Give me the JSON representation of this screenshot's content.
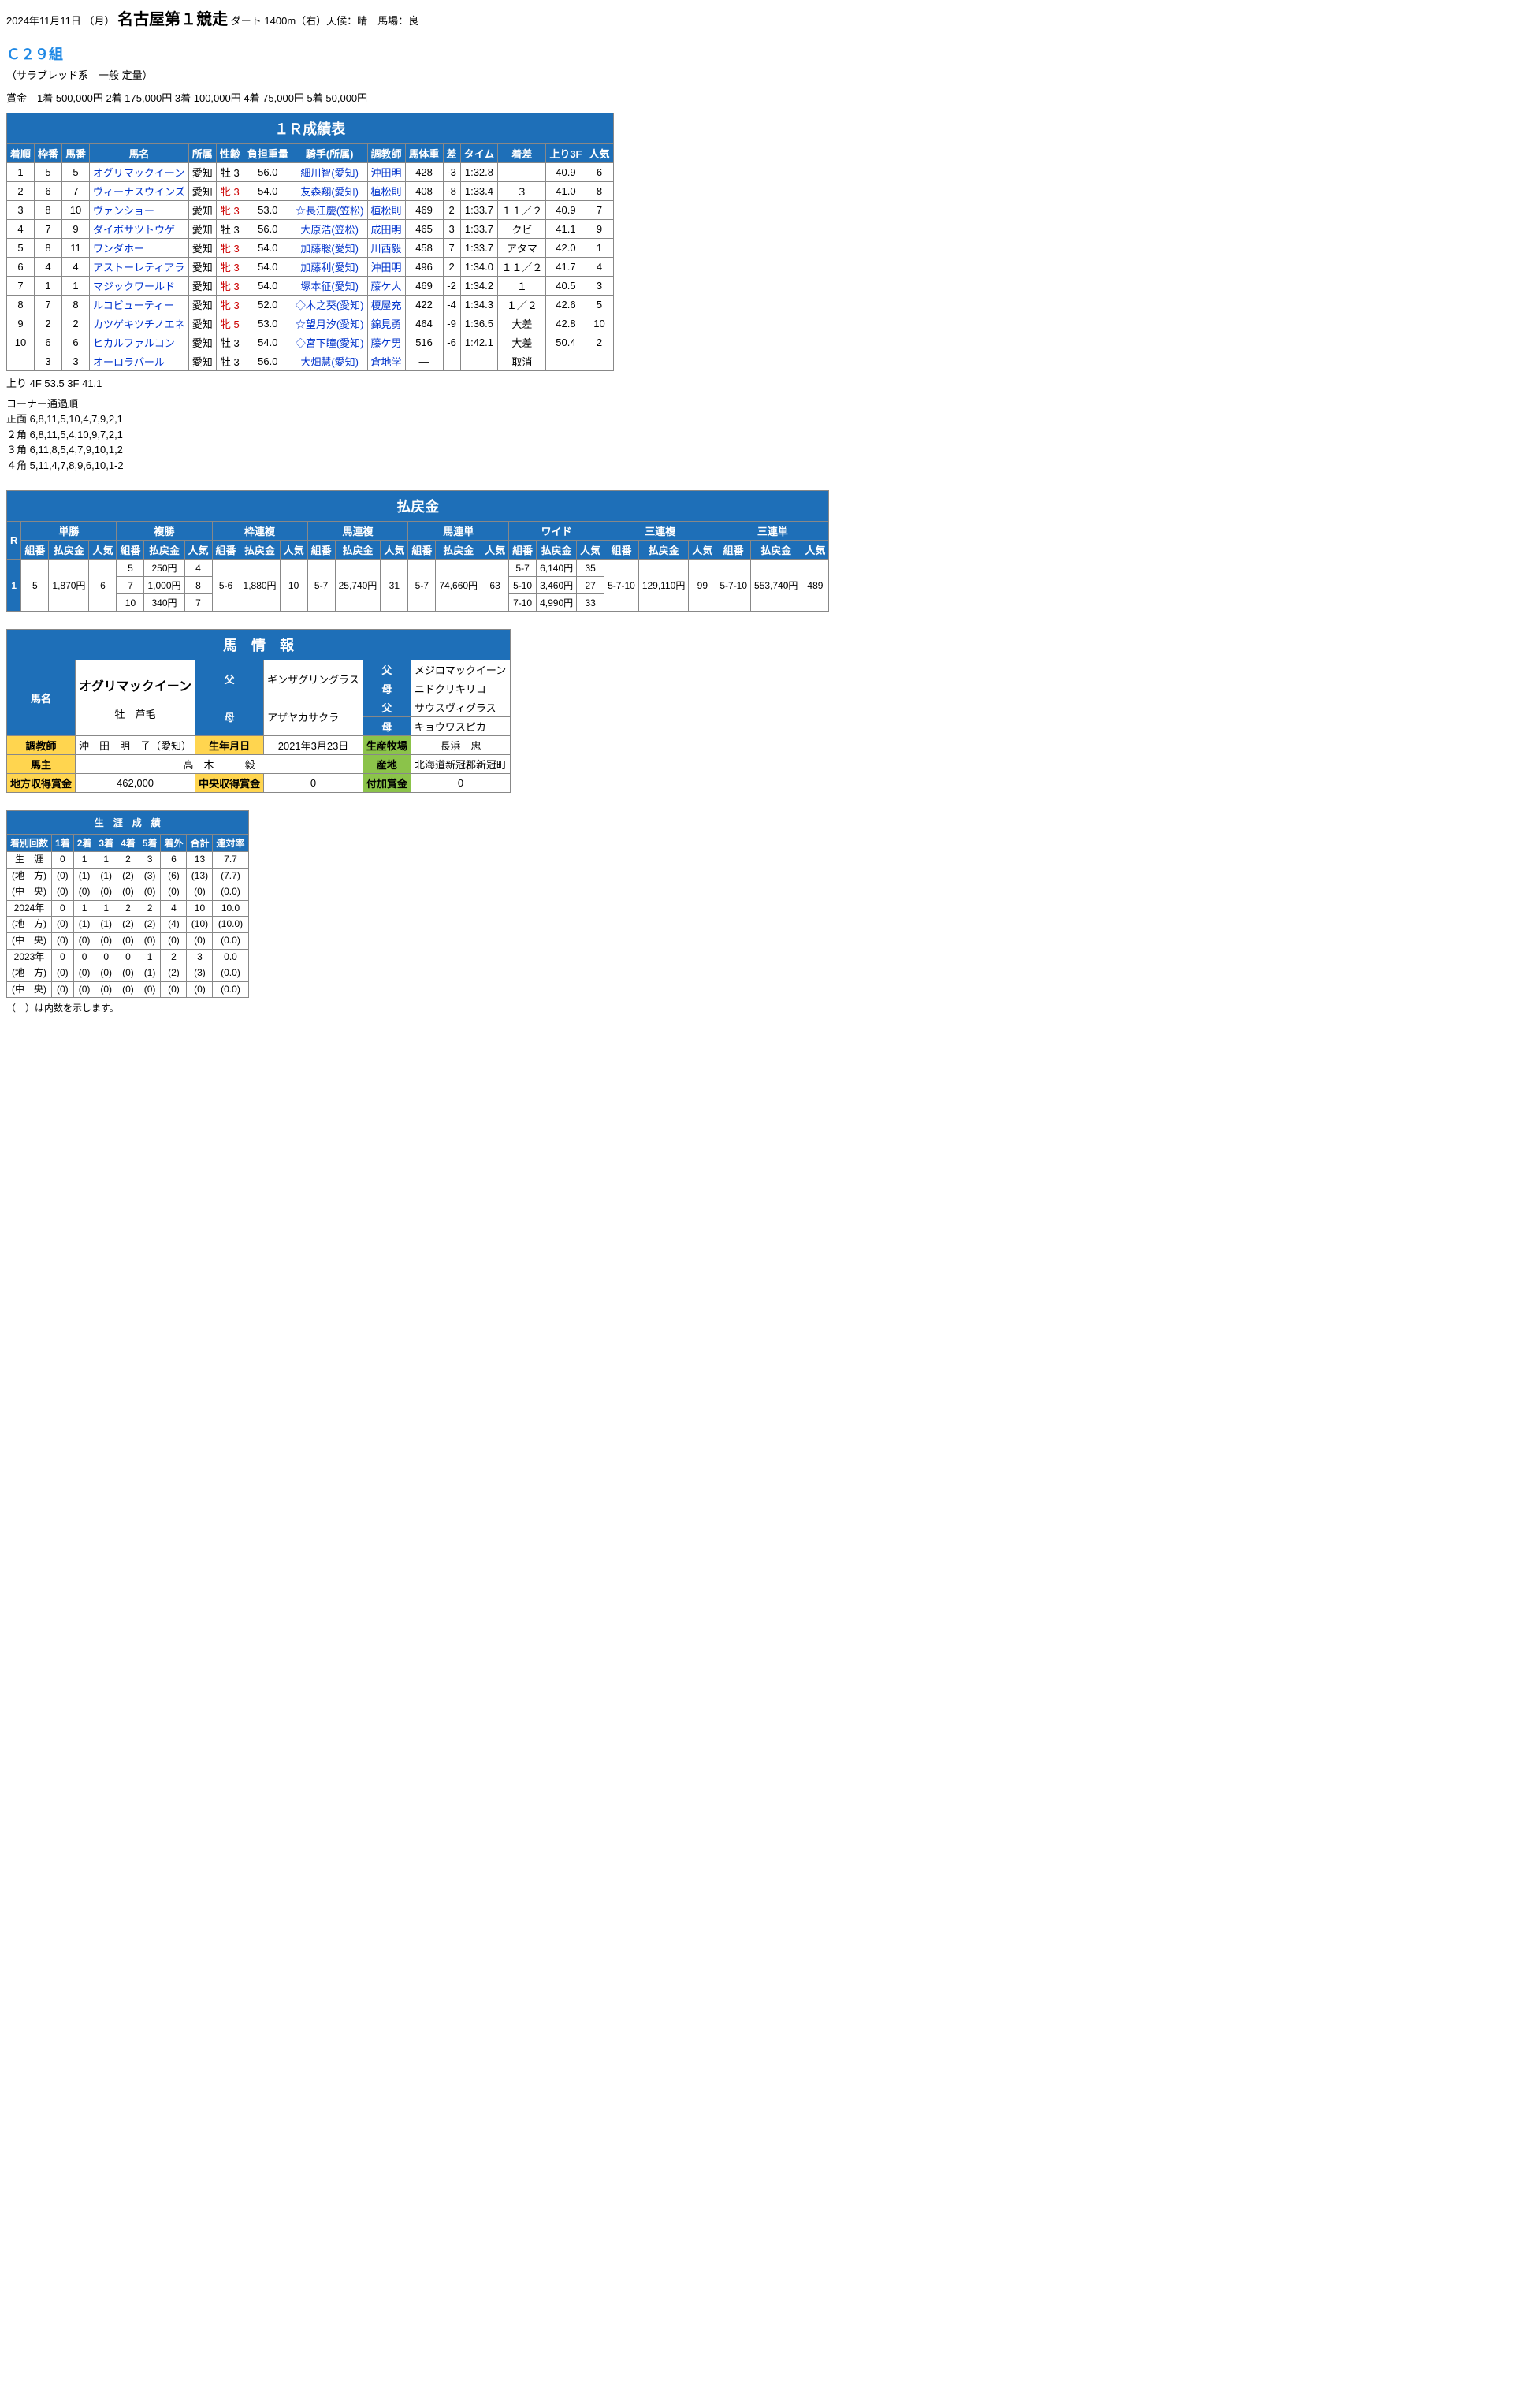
{
  "header": {
    "date": "2024年11月11日 （月）",
    "track": "名古屋第１競走",
    "course": "ダート 1400m（右）天候：晴　馬場：良"
  },
  "class": {
    "name": "Ｃ２９組",
    "detail": "（サラブレッド系　一般 定量）"
  },
  "prize": "賞金　1着 500,000円  2着 175,000円  3着 100,000円  4着 75,000円  5着 50,000円",
  "results": {
    "title": "１Ｒ成績表",
    "headers": [
      "着順",
      "枠番",
      "馬番",
      "馬名",
      "所属",
      "性齢",
      "負担重量",
      "騎手(所属)",
      "調教師",
      "馬体重",
      "差",
      "タイム",
      "着差",
      "上り3F",
      "人気"
    ],
    "rows": [
      {
        "fin": "1",
        "waku": "5",
        "uma": "5",
        "horse": "オグリマックイーン",
        "aff": "愛知",
        "sex": "牡 3",
        "sexClass": "",
        "wt": "56.0",
        "jockey": "細川智(愛知)",
        "trainer": "沖田明",
        "bw": "428",
        "diff": "-3",
        "time": "1:32.8",
        "margin": "",
        "f3": "40.9",
        "pop": "6"
      },
      {
        "fin": "2",
        "waku": "6",
        "uma": "7",
        "horse": "ヴィーナスウインズ",
        "aff": "愛知",
        "sex": "牝 3",
        "sexClass": "mare",
        "wt": "54.0",
        "jockey": "友森翔(愛知)",
        "trainer": "植松則",
        "bw": "408",
        "diff": "-8",
        "time": "1:33.4",
        "margin": "３",
        "f3": "41.0",
        "pop": "8"
      },
      {
        "fin": "3",
        "waku": "8",
        "uma": "10",
        "horse": "ヴァンショー",
        "aff": "愛知",
        "sex": "牝 3",
        "sexClass": "mare",
        "wt": "53.0",
        "jockey": "☆長江慶(笠松)",
        "trainer": "植松則",
        "bw": "469",
        "diff": "2",
        "time": "1:33.7",
        "margin": "１１／２",
        "f3": "40.9",
        "pop": "7"
      },
      {
        "fin": "4",
        "waku": "7",
        "uma": "9",
        "horse": "ダイボサツトウゲ",
        "aff": "愛知",
        "sex": "牡 3",
        "sexClass": "",
        "wt": "56.0",
        "jockey": "大原浩(笠松)",
        "trainer": "成田明",
        "bw": "465",
        "diff": "3",
        "time": "1:33.7",
        "margin": "クビ",
        "f3": "41.1",
        "pop": "9"
      },
      {
        "fin": "5",
        "waku": "8",
        "uma": "11",
        "horse": "ワンダホー",
        "aff": "愛知",
        "sex": "牝 3",
        "sexClass": "mare",
        "wt": "54.0",
        "jockey": "加藤聡(愛知)",
        "trainer": "川西毅",
        "bw": "458",
        "diff": "7",
        "time": "1:33.7",
        "margin": "アタマ",
        "f3": "42.0",
        "pop": "1"
      },
      {
        "fin": "6",
        "waku": "4",
        "uma": "4",
        "horse": "アストーレティアラ",
        "aff": "愛知",
        "sex": "牝 3",
        "sexClass": "mare",
        "wt": "54.0",
        "jockey": "加藤利(愛知)",
        "trainer": "沖田明",
        "bw": "496",
        "diff": "2",
        "time": "1:34.0",
        "margin": "１１／２",
        "f3": "41.7",
        "pop": "4"
      },
      {
        "fin": "7",
        "waku": "1",
        "uma": "1",
        "horse": "マジックワールド",
        "aff": "愛知",
        "sex": "牝 3",
        "sexClass": "mare",
        "wt": "54.0",
        "jockey": "塚本征(愛知)",
        "trainer": "藤ケ人",
        "bw": "469",
        "diff": "-2",
        "time": "1:34.2",
        "margin": "１",
        "f3": "40.5",
        "pop": "3"
      },
      {
        "fin": "8",
        "waku": "7",
        "uma": "8",
        "horse": "ルコビューティー",
        "aff": "愛知",
        "sex": "牝 3",
        "sexClass": "mare",
        "wt": "52.0",
        "jockey": "◇木之葵(愛知)",
        "trainer": "榎屋充",
        "bw": "422",
        "diff": "-4",
        "time": "1:34.3",
        "margin": "１／２",
        "f3": "42.6",
        "pop": "5"
      },
      {
        "fin": "9",
        "waku": "2",
        "uma": "2",
        "horse": "カツゲキツチノエネ",
        "aff": "愛知",
        "sex": "牝 5",
        "sexClass": "mare",
        "wt": "53.0",
        "jockey": "☆望月汐(愛知)",
        "trainer": "錦見勇",
        "bw": "464",
        "diff": "-9",
        "time": "1:36.5",
        "margin": "大差",
        "f3": "42.8",
        "pop": "10"
      },
      {
        "fin": "10",
        "waku": "6",
        "uma": "6",
        "horse": "ヒカルファルコン",
        "aff": "愛知",
        "sex": "牡 3",
        "sexClass": "",
        "wt": "54.0",
        "jockey": "◇宮下瞳(愛知)",
        "trainer": "藤ケ男",
        "bw": "516",
        "diff": "-6",
        "time": "1:42.1",
        "margin": "大差",
        "f3": "50.4",
        "pop": "2"
      },
      {
        "fin": "",
        "waku": "3",
        "uma": "3",
        "horse": "オーロラパール",
        "aff": "愛知",
        "sex": "牡 3",
        "sexClass": "",
        "wt": "56.0",
        "jockey": "大畑慧(愛知)",
        "trainer": "倉地学",
        "bw": "—",
        "diff": "",
        "time": "",
        "margin": "取消",
        "f3": "",
        "pop": ""
      }
    ],
    "agari": "上り  4F 53.5 3F 41.1",
    "corners": {
      "title": "コーナー通過順",
      "lines": [
        "正面 6,8,11,5,10,4,7,9,2,1",
        "２角 6,8,11,5,4,10,9,7,2,1",
        "３角 6,11,8,5,4,7,9,10,1,2",
        "４角 5,11,4,7,8,9,6,10,1-2"
      ]
    }
  },
  "payout": {
    "title": "払戻金",
    "r": "1",
    "cats": [
      "単勝",
      "複勝",
      "枠連複",
      "馬連複",
      "馬連単",
      "ワイド",
      "三連複",
      "三連単"
    ],
    "sub": [
      "組番",
      "払戻金",
      "人気"
    ],
    "data": {
      "tan": [
        [
          "5",
          "1,870円",
          "6"
        ]
      ],
      "fuku": [
        [
          "5",
          "250円",
          "4"
        ],
        [
          "7",
          "1,000円",
          "8"
        ],
        [
          "10",
          "340円",
          "7"
        ]
      ],
      "wakuren": [
        [
          "5-6",
          "1,880円",
          "10"
        ]
      ],
      "umaren": [
        [
          "5-7",
          "25,740円",
          "31"
        ]
      ],
      "umatan": [
        [
          "5-7",
          "74,660円",
          "63"
        ]
      ],
      "wide": [
        [
          "5-7",
          "6,140円",
          "35"
        ],
        [
          "5-10",
          "3,460円",
          "27"
        ],
        [
          "7-10",
          "4,990円",
          "33"
        ]
      ],
      "sanfuku": [
        [
          "5-7-10",
          "129,110円",
          "99"
        ]
      ],
      "santan": [
        [
          "5-7-10",
          "553,740円",
          "489"
        ]
      ]
    }
  },
  "horseinfo": {
    "title": "馬　情　報",
    "name": "オグリマックイーン",
    "prof": "牡　芦毛",
    "sire": "ギンザグリングラス",
    "dam": "アザヤカサクラ",
    "ss": "メジロマックイーン",
    "sd": "ニドクリキリコ",
    "ds": "サウスヴィグラス",
    "dd": "キョウワスピカ",
    "trainer": "沖　田　明　子（愛知）",
    "birth": "2021年3月23日",
    "breeder": "長浜　忠",
    "owner": "高　木　　　毅",
    "origin": "北海道新冠郡新冠町",
    "localprize": "462,000",
    "centralprize": "0",
    "bonus": "0",
    "lbl": {
      "name": "馬名",
      "sire": "父",
      "dam": "母",
      "trainer": "調教師",
      "birth": "生年月日",
      "breeder": "生産牧場",
      "owner": "馬主",
      "origin": "産地",
      "local": "地方収得賞金",
      "central": "中央収得賞金",
      "bonus": "付加賞金"
    }
  },
  "career": {
    "title": "生　涯　成　績",
    "headers": [
      "着別回数",
      "1着",
      "2着",
      "3着",
      "4着",
      "5着",
      "着外",
      "合計",
      "連対率"
    ],
    "rows": [
      {
        "lbl": "生　涯",
        "c": [
          "0",
          "1",
          "1",
          "2",
          "3",
          "6",
          "13",
          "7.7"
        ]
      },
      {
        "lbl": "(地　方)",
        "c": [
          "(0)",
          "(1)",
          "(1)",
          "(2)",
          "(3)",
          "(6)",
          "(13)",
          "(7.7)"
        ]
      },
      {
        "lbl": "(中　央)",
        "c": [
          "(0)",
          "(0)",
          "(0)",
          "(0)",
          "(0)",
          "(0)",
          "(0)",
          "(0.0)"
        ]
      },
      {
        "lbl": "2024年",
        "c": [
          "0",
          "1",
          "1",
          "2",
          "2",
          "4",
          "10",
          "10.0"
        ]
      },
      {
        "lbl": "(地　方)",
        "c": [
          "(0)",
          "(1)",
          "(1)",
          "(2)",
          "(2)",
          "(4)",
          "(10)",
          "(10.0)"
        ]
      },
      {
        "lbl": "(中　央)",
        "c": [
          "(0)",
          "(0)",
          "(0)",
          "(0)",
          "(0)",
          "(0)",
          "(0)",
          "(0.0)"
        ]
      },
      {
        "lbl": "2023年",
        "c": [
          "0",
          "0",
          "0",
          "0",
          "1",
          "2",
          "3",
          "0.0"
        ]
      },
      {
        "lbl": "(地　方)",
        "c": [
          "(0)",
          "(0)",
          "(0)",
          "(0)",
          "(1)",
          "(2)",
          "(3)",
          "(0.0)"
        ]
      },
      {
        "lbl": "(中　央)",
        "c": [
          "(0)",
          "(0)",
          "(0)",
          "(0)",
          "(0)",
          "(0)",
          "(0)",
          "(0.0)"
        ]
      }
    ],
    "note": "（　）は内数を示します。"
  }
}
